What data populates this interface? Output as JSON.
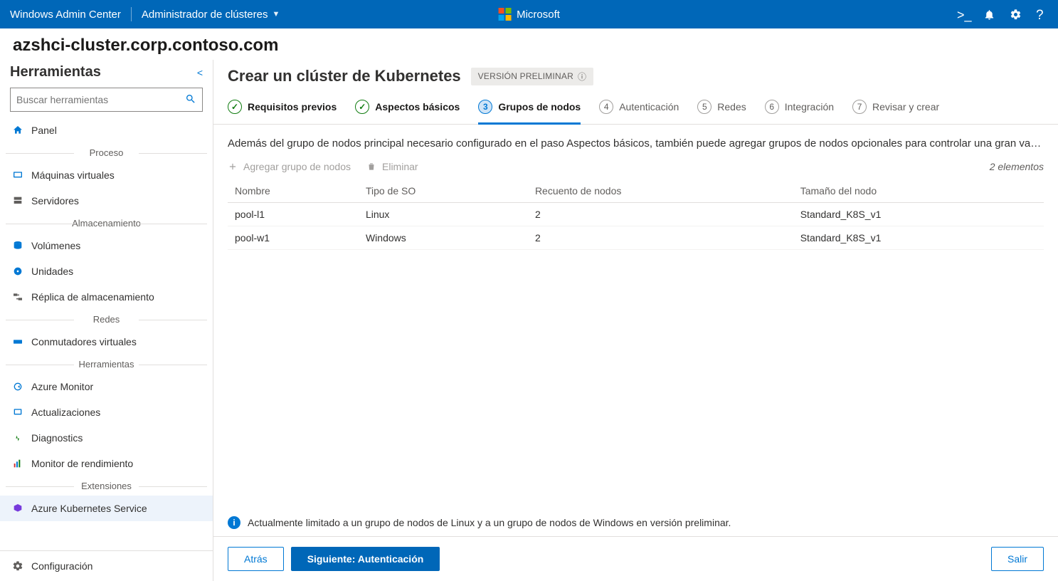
{
  "topbar": {
    "product": "Windows Admin Center",
    "context": "Administrador de clústeres",
    "ms": "Microsoft"
  },
  "cluster_title": "azshci-cluster.corp.contoso.com",
  "sidebar": {
    "title": "Herramientas",
    "search_placeholder": "Buscar herramientas",
    "groups": [
      {
        "label": "",
        "items": [
          {
            "name": "panel",
            "label": "Panel"
          }
        ]
      },
      {
        "label": "Proceso",
        "items": [
          {
            "name": "vms",
            "label": "Máquinas virtuales"
          },
          {
            "name": "servers",
            "label": "Servidores"
          }
        ]
      },
      {
        "label": "Almacenamiento",
        "items": [
          {
            "name": "volumes",
            "label": "Volúmenes"
          },
          {
            "name": "drives",
            "label": "Unidades"
          },
          {
            "name": "storrep",
            "label": "Réplica de almacenamiento"
          }
        ]
      },
      {
        "label": "Redes",
        "items": [
          {
            "name": "vswitches",
            "label": "Conmutadores virtuales"
          }
        ]
      },
      {
        "label": "Herramientas",
        "items": [
          {
            "name": "azmon",
            "label": "Azure Monitor"
          },
          {
            "name": "updates",
            "label": "Actualizaciones"
          },
          {
            "name": "diag",
            "label": "Diagnostics"
          },
          {
            "name": "perfmon",
            "label": "Monitor de rendimiento"
          }
        ]
      },
      {
        "label": "Extensiones",
        "items": [
          {
            "name": "aks",
            "label": "Azure Kubernetes Service",
            "selected": true
          }
        ]
      }
    ],
    "footer": {
      "label": "Configuración"
    }
  },
  "main": {
    "title": "Crear un clúster de Kubernetes",
    "preview_badge": "VERSIÓN PRELIMINAR",
    "steps": [
      {
        "num": "✓",
        "label": "Requisitos previos",
        "state": "done"
      },
      {
        "num": "✓",
        "label": "Aspectos básicos",
        "state": "done"
      },
      {
        "num": "3",
        "label": "Grupos de nodos",
        "state": "active"
      },
      {
        "num": "4",
        "label": "Autenticación",
        "state": "pending"
      },
      {
        "num": "5",
        "label": "Redes",
        "state": "pending"
      },
      {
        "num": "6",
        "label": "Integración",
        "state": "pending"
      },
      {
        "num": "7",
        "label": "Revisar y crear",
        "state": "pending"
      }
    ],
    "intro": "Además del grupo de nodos principal necesario configurado en el paso Aspectos básicos, también puede agregar grupos de nodos opcionales para controlar una gran varie…",
    "toolbar": {
      "add": "Agregar grupo de nodos",
      "delete": "Eliminar",
      "count": "2 elementos"
    },
    "table": {
      "cols": [
        "Nombre",
        "Tipo de SO",
        "Recuento de nodos",
        "Tamaño del nodo"
      ],
      "rows": [
        {
          "name": "pool-l1",
          "os": "Linux",
          "count": "2",
          "size": "Standard_K8S_v1"
        },
        {
          "name": "pool-w1",
          "os": "Windows",
          "count": "2",
          "size": "Standard_K8S_v1"
        }
      ]
    },
    "info": "Actualmente limitado a un grupo de nodos de Linux y a un grupo de nodos de Windows en versión preliminar.",
    "footer": {
      "back": "Atrás",
      "next": "Siguiente: Autenticación",
      "exit": "Salir"
    }
  }
}
